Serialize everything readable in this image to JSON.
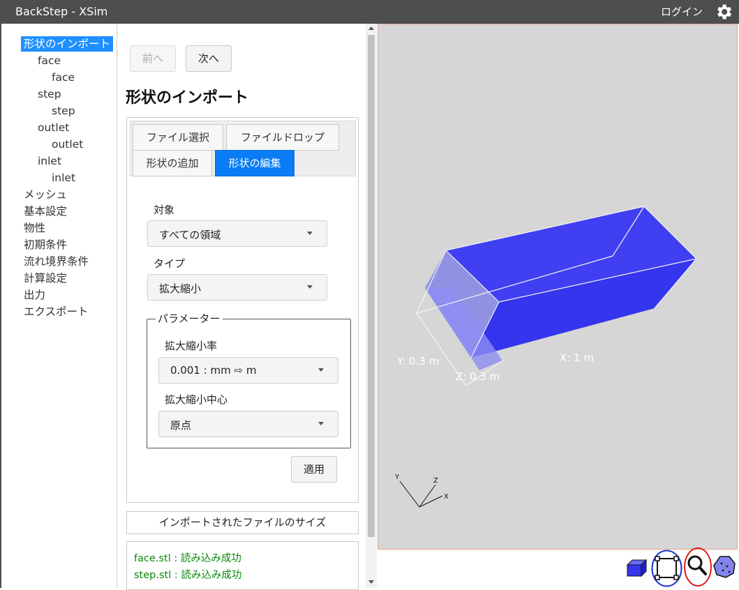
{
  "titlebar": {
    "app_title": "BackStep - XSim",
    "login_label": "ログイン",
    "settings_icon": "gear-icon"
  },
  "sidebar": {
    "items": [
      {
        "label": "形状のインポート",
        "level": 0,
        "active": true
      },
      {
        "label": "face",
        "level": 1
      },
      {
        "label": "face",
        "level": 2
      },
      {
        "label": "step",
        "level": 1
      },
      {
        "label": "step",
        "level": 2
      },
      {
        "label": "outlet",
        "level": 1
      },
      {
        "label": "outlet",
        "level": 2
      },
      {
        "label": "inlet",
        "level": 1
      },
      {
        "label": "inlet",
        "level": 2
      },
      {
        "label": "メッシュ",
        "level": 0
      },
      {
        "label": "基本設定",
        "level": 0
      },
      {
        "label": "物性",
        "level": 0
      },
      {
        "label": "初期条件",
        "level": 0
      },
      {
        "label": "流れ境界条件",
        "level": 0
      },
      {
        "label": "計算設定",
        "level": 0
      },
      {
        "label": "出力",
        "level": 0
      },
      {
        "label": "エクスポート",
        "level": 0
      }
    ]
  },
  "nav": {
    "prev_label": "前へ",
    "next_label": "次へ"
  },
  "main": {
    "title": "形状のインポート",
    "tabs": [
      {
        "label": "ファイル選択",
        "active": false
      },
      {
        "label": "ファイルドロップ",
        "active": false
      },
      {
        "label": "形状の追加",
        "active": false
      },
      {
        "label": "形状の編集",
        "active": true
      }
    ],
    "target_label": "対象",
    "target_value": "すべての領域",
    "type_label": "タイプ",
    "type_value": "拡大縮小",
    "params_legend": "パラメーター",
    "scale_label": "拡大縮小率",
    "scale_value": "0.001 : mm ⇨ m",
    "center_label": "拡大縮小中心",
    "center_value": "原点",
    "apply_label": "適用",
    "import_size_label": "インポートされたファイルのサイズ",
    "log": [
      "face.stl : 読み込み成功",
      "step.stl : 読み込み成功"
    ]
  },
  "viewport": {
    "dim_x": "X: 1 m",
    "dim_y": "Y: 0.3 m",
    "dim_z": "Z: 0.3 m",
    "axis_x": "X",
    "axis_y": "Y",
    "axis_z": "Z",
    "shape_color": "#3a3af0",
    "background": "#d6d6d6"
  },
  "tools": [
    "cube-icon",
    "fit-frame-icon",
    "zoom-icon",
    "polygon-point-icon"
  ],
  "colors": {
    "active": "#1e90ff",
    "tab_active": "#0a7cf5",
    "log_ok": "#0a8a0a",
    "highlight_blue": "#1a2fd6",
    "highlight_red": "#e01919"
  }
}
